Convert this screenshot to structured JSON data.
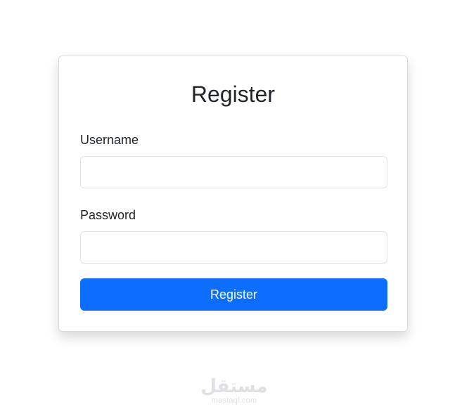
{
  "form": {
    "title": "Register",
    "username_label": "Username",
    "username_value": "",
    "password_label": "Password",
    "password_value": "",
    "submit_label": "Register"
  },
  "watermark": {
    "logo_text": "مستقل",
    "url": "mostaql.com"
  },
  "colors": {
    "primary": "#0d6efd",
    "text": "#212529",
    "border": "#dee2e6",
    "background": "#ffffff"
  }
}
